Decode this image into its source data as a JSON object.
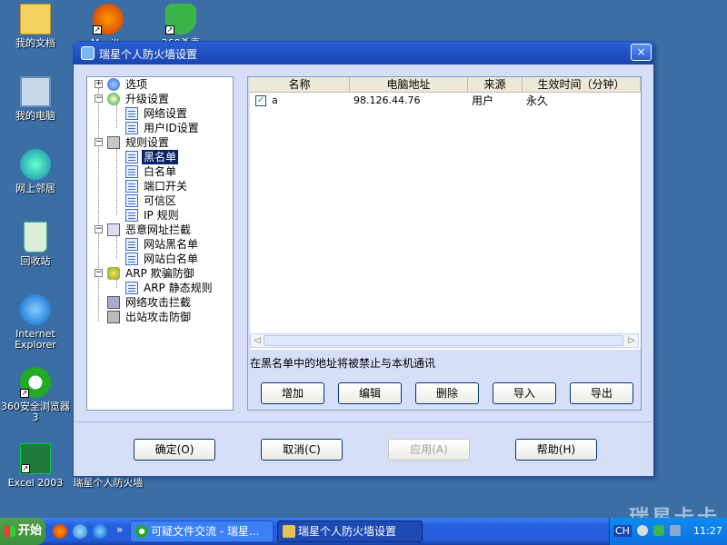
{
  "desktop": {
    "icons": [
      {
        "label": "我的文档"
      },
      {
        "label": "Mozilla"
      },
      {
        "label": "360杀毒"
      },
      {
        "label": "我的电脑"
      },
      {
        "label": "网上邻居"
      },
      {
        "label": "回收站"
      },
      {
        "label": "Internet Explorer"
      },
      {
        "label": "360安全浏览器 3"
      },
      {
        "label": "Excel 2003"
      },
      {
        "label": "瑞星个人防火墙"
      }
    ]
  },
  "window": {
    "title": "瑞星个人防火墙设置",
    "close_label": "×"
  },
  "tree": [
    {
      "label": "选项",
      "icon": "gear-icon"
    },
    {
      "label": "升级设置",
      "icon": "update-icon"
    },
    {
      "label": "网络设置",
      "icon": "doc-icon"
    },
    {
      "label": "用户ID设置",
      "icon": "doc-icon"
    },
    {
      "label": "规则设置",
      "icon": "rules-icon"
    },
    {
      "label": "黑名单",
      "icon": "doc-icon"
    },
    {
      "label": "白名单",
      "icon": "doc-icon"
    },
    {
      "label": "端口开关",
      "icon": "doc-icon"
    },
    {
      "label": "可信区",
      "icon": "doc-icon"
    },
    {
      "label": "IP 规则",
      "icon": "doc-icon"
    },
    {
      "label": "恶意网址拦截",
      "icon": "url-block-icon"
    },
    {
      "label": "网站黑名单",
      "icon": "doc-icon"
    },
    {
      "label": "网站白名单",
      "icon": "doc-icon"
    },
    {
      "label": "ARP 欺骗防御",
      "icon": "arp-icon"
    },
    {
      "label": "ARP 静态规则",
      "icon": "doc-icon"
    },
    {
      "label": "网络攻击拦截",
      "icon": "attack-block-icon"
    },
    {
      "label": "出站攻击防御",
      "icon": "outbound-defense-icon"
    }
  ],
  "list": {
    "columns": [
      "名称",
      "电脑地址",
      "来源",
      "生效时间（分钟）"
    ],
    "rows": [
      {
        "checked": true,
        "name": "a",
        "address": "98.126.44.76",
        "source": "用户",
        "time": "永久"
      }
    ]
  },
  "info_text": "在黑名单中的地址将被禁止与本机通讯",
  "actions": {
    "add": "增加",
    "edit": "编辑",
    "delete": "删除",
    "import": "导入",
    "export": "导出"
  },
  "bottom": {
    "ok": "确定(O)",
    "cancel": "取消(C)",
    "apply": "应用(A)",
    "help": "帮助(H)"
  },
  "taskbar": {
    "start": "开始",
    "tasks": [
      "可疑文件交流 - 瑞星...",
      "瑞星个人防火墙设置"
    ],
    "lang": "CH",
    "time": "11:27"
  },
  "watermark": "瑞星卡卡",
  "colors": {
    "desktop": "#3a6ea5",
    "titlebar": "#1b46b0",
    "selection": "#0a246a"
  }
}
